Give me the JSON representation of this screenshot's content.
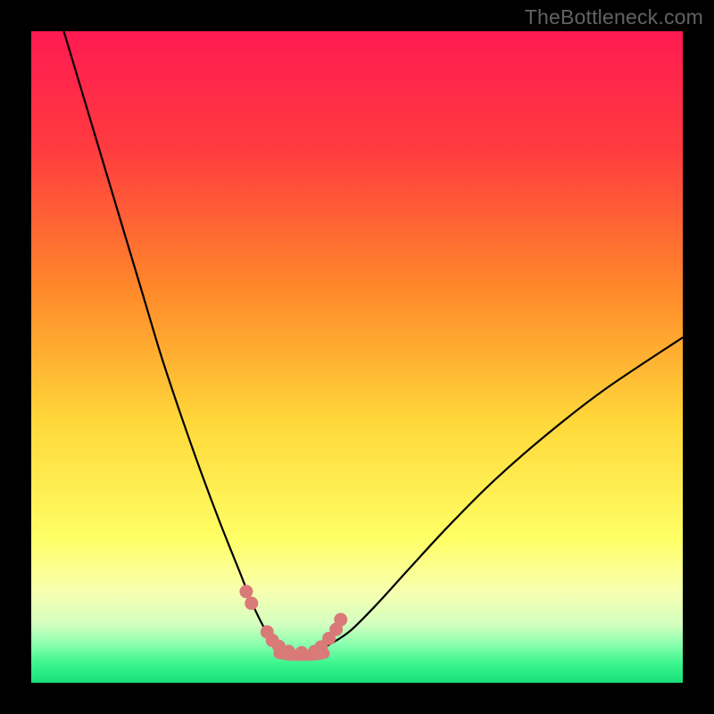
{
  "watermark": "TheBottleneck.com",
  "chart_data": {
    "type": "line",
    "title": "",
    "xlabel": "",
    "ylabel": "",
    "xlim": [
      0,
      100
    ],
    "ylim": [
      0,
      100
    ],
    "series": [
      {
        "name": "left-curve",
        "x": [
          5,
          8,
          11,
          14,
          17,
          20,
          23,
          26,
          29,
          32,
          34,
          36,
          37.5,
          39
        ],
        "y": [
          100,
          90,
          80,
          70,
          60,
          50,
          41,
          32.5,
          24.5,
          17,
          12,
          8,
          6,
          5
        ]
      },
      {
        "name": "right-curve",
        "x": [
          44,
          46,
          49,
          53,
          58,
          64,
          71,
          79,
          88,
          100
        ],
        "y": [
          5,
          6,
          8,
          12,
          17.5,
          24,
          31,
          38,
          45,
          53
        ]
      },
      {
        "name": "bottom-flat",
        "x": [
          38,
          39,
          40,
          41,
          42,
          43,
          44,
          45
        ],
        "y": [
          4.5,
          4.3,
          4.2,
          4.2,
          4.2,
          4.2,
          4.3,
          4.5
        ]
      }
    ],
    "dots": {
      "name": "dots",
      "x": [
        33,
        33.8,
        36.2,
        37,
        38,
        39.5,
        41.5,
        43.5,
        44.5,
        45.7,
        46.8,
        47.5
      ],
      "y": [
        14,
        12.2,
        7.8,
        6.5,
        5.6,
        4.8,
        4.6,
        4.8,
        5.5,
        6.8,
        8.2,
        9.7
      ]
    },
    "gradient_stops": [
      {
        "offset": 0,
        "color": "#ff1a52"
      },
      {
        "offset": 18,
        "color": "#ff3b3f"
      },
      {
        "offset": 40,
        "color": "#ff8a2a"
      },
      {
        "offset": 60,
        "color": "#ffd83a"
      },
      {
        "offset": 78,
        "color": "#ffff66"
      },
      {
        "offset": 86,
        "color": "#f7ffb0"
      },
      {
        "offset": 91,
        "color": "#d4ffc0"
      },
      {
        "offset": 94,
        "color": "#8dffb0"
      },
      {
        "offset": 97,
        "color": "#3cf58d"
      },
      {
        "offset": 100,
        "color": "#18e07a"
      }
    ],
    "dot_color": "#d97a78",
    "curve_color": "#000000"
  }
}
